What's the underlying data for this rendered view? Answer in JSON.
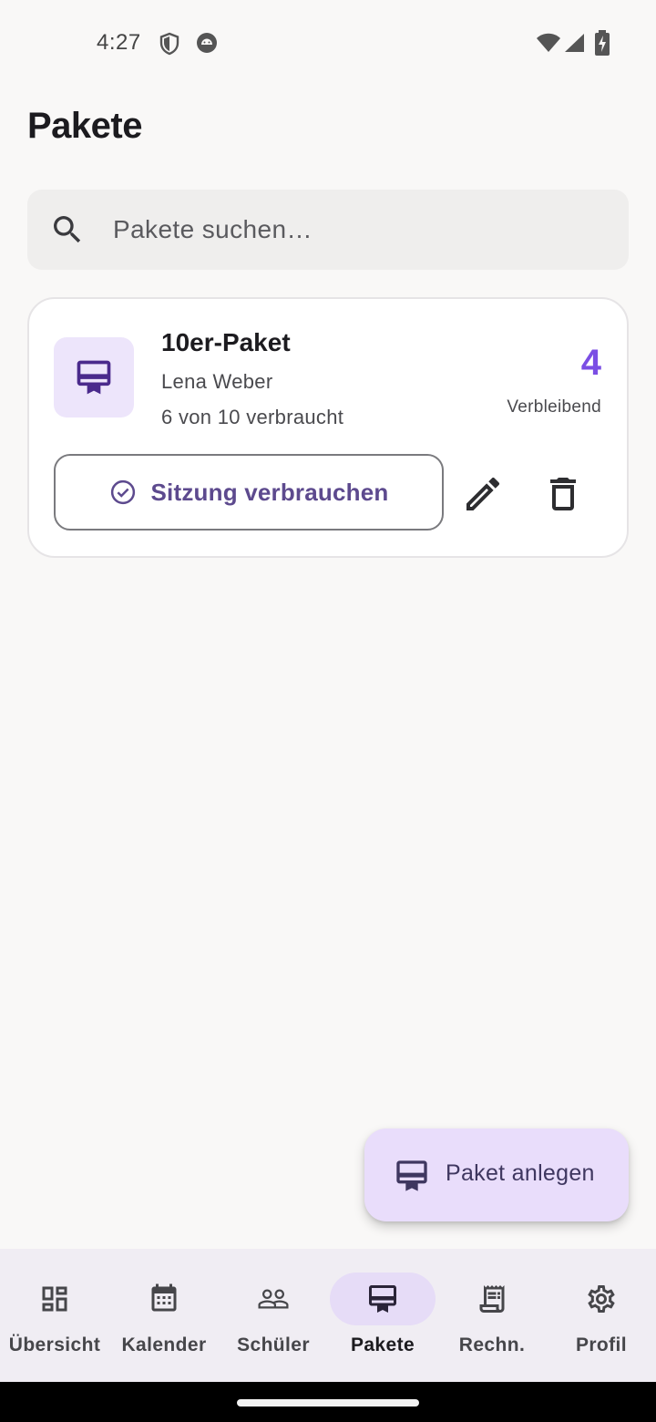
{
  "status_bar": {
    "time": "4:27",
    "icons": [
      "shield-icon",
      "android-debug-icon",
      "wifi-icon",
      "signal-icon",
      "battery-charging-icon"
    ]
  },
  "header": {
    "title": "Pakete"
  },
  "search": {
    "placeholder": "Pakete suchen…",
    "value": ""
  },
  "packages": [
    {
      "icon": "card-membership-icon",
      "title": "10er-Paket",
      "student": "Lena Weber",
      "usage": "6 von 10 verbraucht",
      "remaining": "4",
      "remaining_label": "Verbleibend",
      "consume_label": "Sitzung verbrauchen",
      "edit_icon": "edit-icon",
      "delete_icon": "delete-icon"
    }
  ],
  "fab": {
    "label": "Paket anlegen",
    "icon": "card-membership-icon"
  },
  "nav": {
    "items": [
      {
        "label": "Übersicht",
        "icon": "dashboard-icon",
        "active": false
      },
      {
        "label": "Kalender",
        "icon": "calendar-icon",
        "active": false
      },
      {
        "label": "Schüler",
        "icon": "people-icon",
        "active": false
      },
      {
        "label": "Pakete",
        "icon": "card-membership-icon",
        "active": true
      },
      {
        "label": "Rechn.",
        "icon": "receipt-icon",
        "active": false
      },
      {
        "label": "Profil",
        "icon": "settings-icon",
        "active": false
      }
    ]
  },
  "colors": {
    "accent": "#7b4ee4",
    "card_icon_bg": "#ede5fb",
    "fab_bg": "#e9ddfb",
    "nav_bg": "#f0edf3",
    "nav_active_indicator": "#e6dcf7",
    "background": "#f9f8f7"
  }
}
